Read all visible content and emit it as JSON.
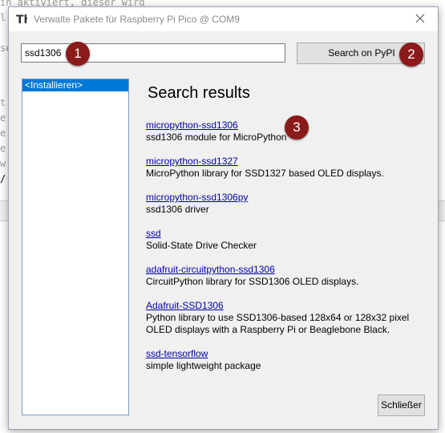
{
  "background_editor": {
    "lines": [
      "in aktiviert, dieser wird",
      "l",
      "",
      "se",
      "",
      "t",
      "e",
      "e",
      "e",
      "w",
      "/"
    ]
  },
  "dialog": {
    "title": "Verwalte Pakete für Raspberry Pi Pico @ COM9",
    "app_icon": "thonny-icon",
    "close_icon": "close-icon"
  },
  "search": {
    "value": "ssd1306",
    "button_label": "Search on PyPI"
  },
  "sidebar": {
    "items": [
      {
        "label": "<Installieren>",
        "selected": true
      }
    ]
  },
  "main": {
    "title": "Search results",
    "results": [
      {
        "name": "micropython-ssd1306",
        "description": "ssd1306 module for MicroPython"
      },
      {
        "name": "micropython-ssd1327",
        "description": "MicroPython library for SSD1327 based OLED displays."
      },
      {
        "name": "micropython-ssd1306py",
        "description": "ssd1306 driver"
      },
      {
        "name": "ssd",
        "description": "Solid-State Drive Checker"
      },
      {
        "name": "adafruit-circuitpython-ssd1306",
        "description": "CircuitPython library for SSD1306 OLED displays."
      },
      {
        "name": "Adafruit-SSD1306",
        "description": "Python library to use SSD1306-based 128x64 or 128x32 pixel OLED displays with a Raspberry Pi or Beaglebone Black."
      },
      {
        "name": "ssd-tensorflow",
        "description": "simple lightweight package"
      }
    ]
  },
  "footer": {
    "close_label": "Schließer"
  },
  "badges": [
    "1",
    "2",
    "3"
  ],
  "colors": {
    "badge": "#8b1a1a",
    "selection": "#0078d7",
    "link": "#0000aa"
  }
}
